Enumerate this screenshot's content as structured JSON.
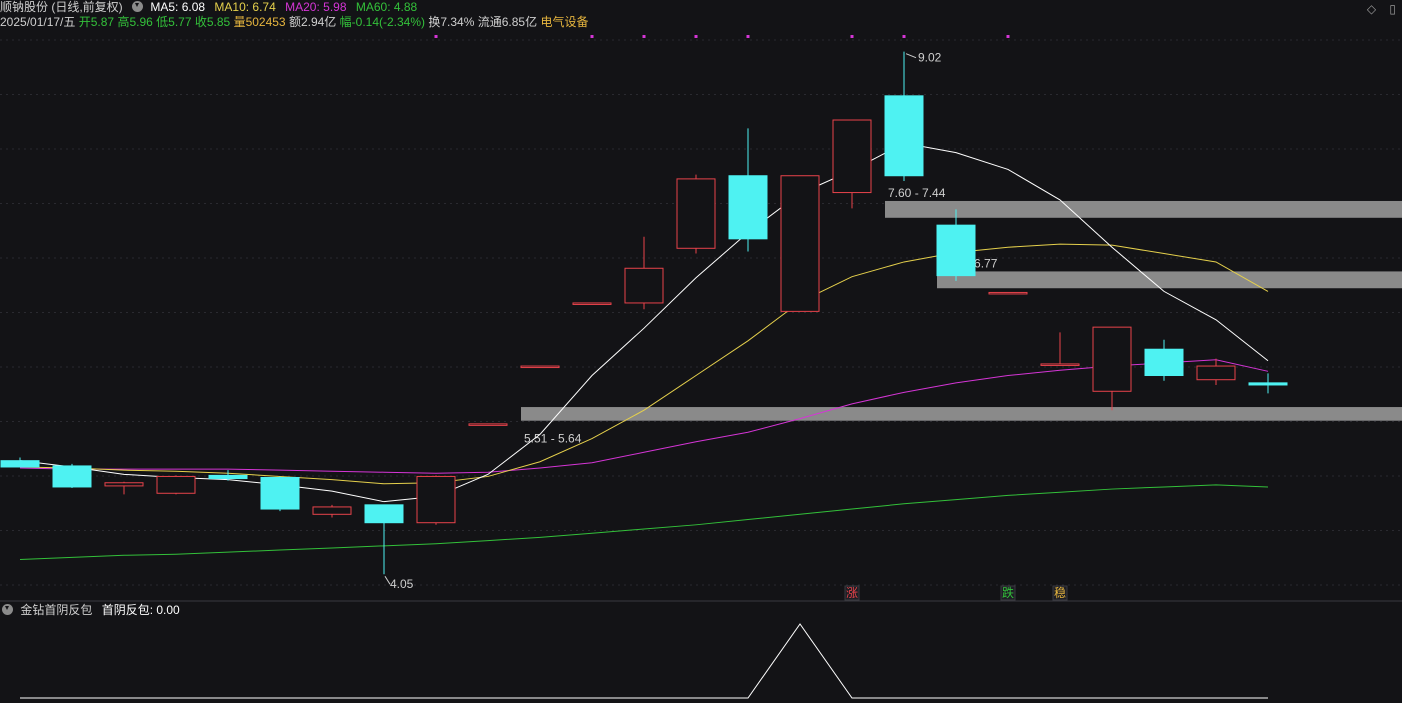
{
  "header": {
    "stock_name": "顺钠股份 (日线,前复权)",
    "ma5": "MA5: 6.08",
    "ma10": "MA10: 6.74",
    "ma20": "MA20: 5.98",
    "ma60": "MA60: 4.88",
    "date": "2025/01/17/五",
    "open": "开5.87",
    "high": "高5.96",
    "low": "低5.77",
    "close": "收5.85",
    "volume": "量502453",
    "amount": "额2.94亿",
    "change": "幅-0.14(-2.34%)",
    "turnover": "换7.34%",
    "float": "流通6.85亿",
    "sector": "电气设备"
  },
  "indicator": {
    "label": "金钻首阴反包",
    "value": "首阴反包: 0.00"
  },
  "colors": {
    "up": "#e8434b",
    "down": "#4ef2f2",
    "ma5": "#ffffff",
    "ma10": "#e5d04c",
    "ma20": "#d535d6",
    "ma60": "#33c03a",
    "zone": "#8a8a8a",
    "sector": "#e6b53e"
  },
  "corner_icons": [
    "diamond-icon",
    "square-icon"
  ],
  "chart_data": {
    "type": "candlestick",
    "ylim": [
      3.9,
      9.15
    ],
    "candles": [
      {
        "o": 5.13,
        "h": 5.16,
        "l": 5.09,
        "c": 5.07
      },
      {
        "o": 5.08,
        "h": 5.1,
        "l": 4.87,
        "c": 4.88
      },
      {
        "o": 4.89,
        "h": 4.93,
        "l": 4.81,
        "c": 4.92
      },
      {
        "o": 4.82,
        "h": 4.99,
        "l": 4.81,
        "c": 4.98
      },
      {
        "o": 4.99,
        "h": 5.04,
        "l": 4.94,
        "c": 4.96
      },
      {
        "o": 4.97,
        "h": 4.98,
        "l": 4.65,
        "c": 4.67
      },
      {
        "o": 4.62,
        "h": 4.71,
        "l": 4.59,
        "c": 4.69
      },
      {
        "o": 4.71,
        "h": 4.71,
        "l": 4.05,
        "c": 4.54
      },
      {
        "o": 4.54,
        "h": 4.99,
        "l": 4.52,
        "c": 4.98
      },
      {
        "o": 5.48,
        "h": 5.48,
        "l": 5.48,
        "c": 5.48
      },
      {
        "o": 6.03,
        "h": 6.03,
        "l": 6.03,
        "c": 6.03
      },
      {
        "o": 6.63,
        "h": 6.63,
        "l": 6.63,
        "c": 6.63
      },
      {
        "o": 6.63,
        "h": 7.26,
        "l": 6.57,
        "c": 6.96
      },
      {
        "o": 7.15,
        "h": 7.85,
        "l": 7.1,
        "c": 7.81
      },
      {
        "o": 7.84,
        "h": 8.29,
        "l": 7.12,
        "c": 7.24
      },
      {
        "o": 6.55,
        "h": 7.83,
        "l": 6.55,
        "c": 7.84
      },
      {
        "o": 7.68,
        "h": 8.37,
        "l": 7.53,
        "c": 8.37
      },
      {
        "o": 8.6,
        "h": 9.02,
        "l": 7.79,
        "c": 7.84
      },
      {
        "o": 7.37,
        "h": 7.52,
        "l": 6.84,
        "c": 6.89
      },
      {
        "o": 6.73,
        "h": 6.73,
        "l": 6.73,
        "c": 6.73
      },
      {
        "o": 6.05,
        "h": 6.35,
        "l": 6.05,
        "c": 6.05
      },
      {
        "o": 5.79,
        "h": 6.32,
        "l": 5.61,
        "c": 6.4
      },
      {
        "o": 6.19,
        "h": 6.28,
        "l": 5.89,
        "c": 5.94
      },
      {
        "o": 5.9,
        "h": 6.1,
        "l": 5.85,
        "c": 6.03
      },
      {
        "o": 5.87,
        "h": 5.96,
        "l": 5.77,
        "c": 5.85
      }
    ],
    "ma5": [
      5.13,
      5.07,
      5.0,
      4.97,
      4.95,
      4.9,
      4.84,
      4.74,
      4.79,
      5.0,
      5.38,
      5.94,
      6.39,
      6.87,
      7.3,
      7.67,
      7.89,
      8.15,
      8.06,
      7.9,
      7.61,
      7.16,
      6.74,
      6.47,
      6.08
    ],
    "ma10": [
      5.07,
      5.06,
      5.04,
      5.03,
      5.01,
      4.98,
      4.95,
      4.91,
      4.92,
      4.98,
      5.12,
      5.34,
      5.61,
      5.94,
      6.27,
      6.64,
      6.88,
      7.02,
      7.11,
      7.16,
      7.19,
      7.18,
      7.1,
      7.02,
      6.74
    ],
    "ma20": [
      5.06,
      5.05,
      5.05,
      5.05,
      5.05,
      5.04,
      5.03,
      5.02,
      5.01,
      5.02,
      5.06,
      5.11,
      5.21,
      5.31,
      5.4,
      5.53,
      5.67,
      5.78,
      5.87,
      5.94,
      5.99,
      6.03,
      6.06,
      6.09,
      5.98
    ],
    "ma60": [
      4.19,
      4.21,
      4.23,
      4.24,
      4.26,
      4.28,
      4.3,
      4.32,
      4.34,
      4.37,
      4.4,
      4.44,
      4.48,
      4.52,
      4.57,
      4.62,
      4.67,
      4.72,
      4.76,
      4.8,
      4.83,
      4.86,
      4.88,
      4.9,
      4.88
    ],
    "zones": [
      {
        "low": 7.44,
        "high": 7.6,
        "label": "7.60 - 7.44",
        "start": 17
      },
      {
        "low": 6.77,
        "high": 6.93,
        "label": "6.93 - 6.77",
        "start": 18
      },
      {
        "low": 5.51,
        "high": 5.64,
        "label": "5.51 - 5.64",
        "start": 10
      }
    ],
    "high_label": "9.02",
    "low_label": "4.05",
    "markers": [
      {
        "index": 16,
        "text": "涨",
        "color": "#e8434b"
      },
      {
        "index": 19,
        "text": "跌",
        "color": "#33c03a"
      },
      {
        "index": 20,
        "text": "稳",
        "color": "#e6b53e"
      }
    ],
    "top_dots": [
      8,
      11,
      12,
      13,
      14,
      16,
      17,
      19
    ],
    "indicator_values": [
      0,
      0,
      0,
      0,
      0,
      0,
      0,
      0,
      0,
      0,
      0,
      0,
      0,
      0,
      0,
      1,
      0,
      0,
      0,
      0,
      0,
      0,
      0,
      0,
      0
    ]
  }
}
